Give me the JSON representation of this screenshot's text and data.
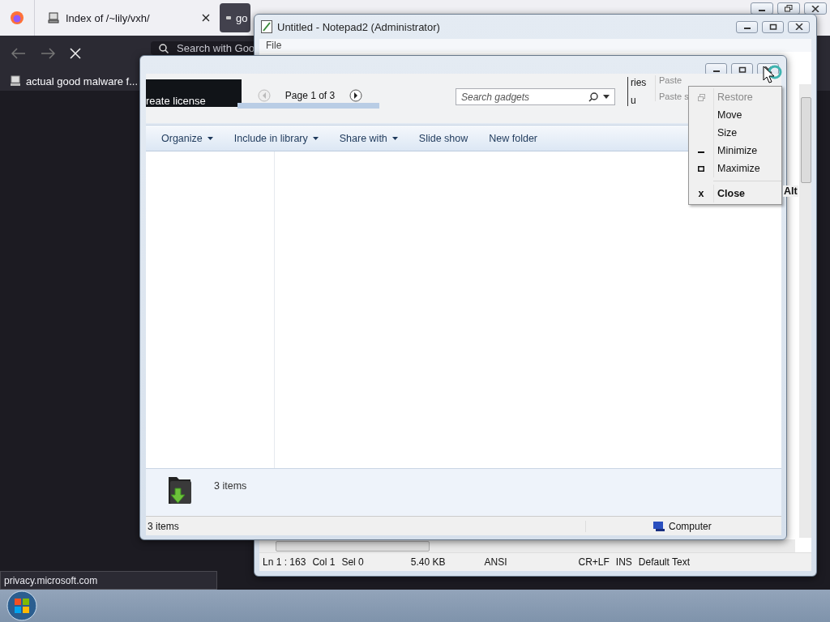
{
  "browser": {
    "tabs": [
      {
        "title": "Index of /~lily/vxh/",
        "selected": true
      },
      {
        "title": "go",
        "selected": false
      }
    ],
    "search_placeholder": "Search with Goo",
    "bookmarks": [
      "actual good malware f..."
    ],
    "status_link": "privacy.microsoft.com"
  },
  "notepad": {
    "title": "Untitled - Notepad2 (Administrator)",
    "menu": [
      "File"
    ],
    "status_bar": [
      "Ln 1 : 163",
      "Col 1",
      "Sel 0",
      "5.40 KB",
      "ANSI",
      "CR+LF",
      "INS",
      "Default Text"
    ]
  },
  "explorer": {
    "gallery": {
      "banner_text": "reate license",
      "page": "Page 1 of 3",
      "search_placeholder": "Search gadgets",
      "fragments": [
        "ries",
        "u",
        "Paste",
        "Paste s"
      ]
    },
    "toolbar": [
      {
        "label": "Organize",
        "dropdown": true
      },
      {
        "label": "Include in library",
        "dropdown": true
      },
      {
        "label": "Share with",
        "dropdown": true
      },
      {
        "label": "Slide show",
        "dropdown": false
      },
      {
        "label": "New folder",
        "dropdown": false
      }
    ],
    "details": "3 items",
    "status_bar": {
      "items": "3 items",
      "location": "Computer"
    }
  },
  "system_menu": {
    "items": [
      {
        "kind": "restore",
        "label": "Restore",
        "disabled": true,
        "default": false
      },
      {
        "kind": "plain",
        "label": "Move",
        "disabled": false,
        "default": false
      },
      {
        "kind": "plain",
        "label": "Size",
        "disabled": false,
        "default": false
      },
      {
        "kind": "minimize",
        "label": "Minimize",
        "disabled": false,
        "default": false
      },
      {
        "kind": "maximize",
        "label": "Maximize",
        "disabled": false,
        "default": false
      },
      {
        "kind": "separator"
      },
      {
        "kind": "glyph",
        "label": "Close",
        "glyph": "x",
        "disabled": false,
        "default": true
      }
    ],
    "overflow": "Alt"
  }
}
